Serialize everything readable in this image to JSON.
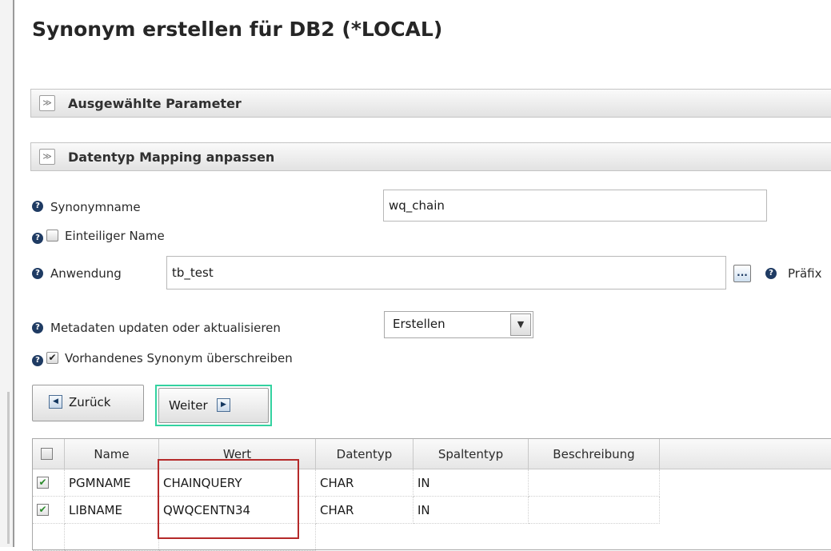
{
  "page": {
    "title": "Synonym erstellen für DB2 (*LOCAL)"
  },
  "panels": [
    {
      "label": "Ausgewählte Parameter",
      "icon": "expand-chevrons-icon"
    },
    {
      "label": "Datentyp Mapping anpassen",
      "icon": "expand-chevrons-icon"
    }
  ],
  "form": {
    "synonymname": {
      "label": "Synonymname",
      "value": "wq_chain"
    },
    "einteiliger": {
      "label": "Einteiliger Name",
      "checked": false
    },
    "anwendung": {
      "label": "Anwendung",
      "value": "tb_test",
      "browse_label": "...",
      "prefix_label": "Präfix"
    },
    "metadaten": {
      "label": "Metadaten updaten oder aktualisieren",
      "selected": "Erstellen"
    },
    "overwrite": {
      "label": "Vorhandenes Synonym überschreiben",
      "checked": true,
      "check_glyph": "✔"
    }
  },
  "buttons": {
    "back": "Zurück",
    "next": "Weiter",
    "back_arrow": "◀",
    "next_arrow": "▶"
  },
  "table": {
    "columns": [
      "Name",
      "Wert",
      "Datentyp",
      "Spaltentyp",
      "Beschreibung"
    ],
    "rows": [
      {
        "checked": true,
        "name": "PGMNAME",
        "wert": "CHAINQUERY",
        "datentyp": "CHAR",
        "spaltentyp": "IN",
        "beschreibung": ""
      },
      {
        "checked": true,
        "name": "LIBNAME",
        "wert": "QWQCENTN34",
        "datentyp": "CHAR",
        "spaltentyp": "IN",
        "beschreibung": ""
      }
    ],
    "check_glyph": "✔"
  },
  "colors": {
    "focus_border": "#33d2a0",
    "highlight_border": "#b52a2a",
    "help_icon": "#1f3b63"
  },
  "icons": {
    "help": "?",
    "toggle": "≫",
    "dropdown": "▼"
  }
}
